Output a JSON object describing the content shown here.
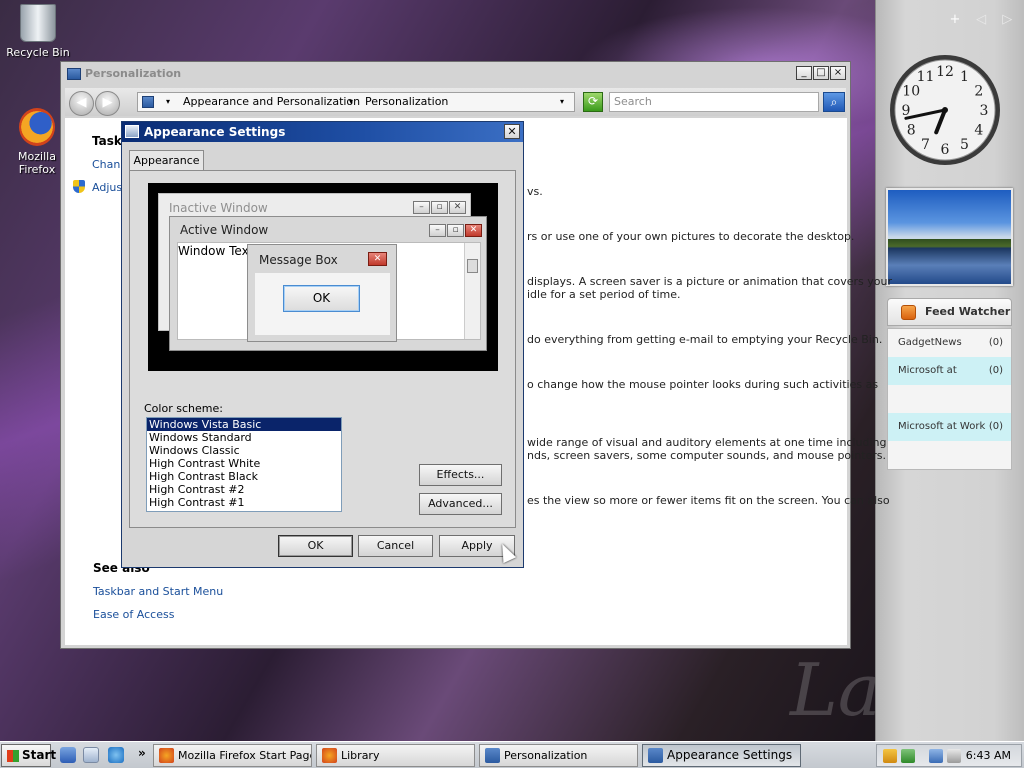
{
  "desktop": {
    "icons": [
      {
        "label": "Recycle Bin",
        "icon": "recycle-bin-icon"
      },
      {
        "label": "Mozilla Firefox",
        "icon": "firefox-icon"
      }
    ],
    "wallpaper_text": "La"
  },
  "sidebar": {
    "controls": [
      "+",
      "◁",
      "▷"
    ],
    "clock": {
      "hour": 6,
      "minute": 43,
      "numbers": [
        "12",
        "1",
        "2",
        "3",
        "4",
        "5",
        "6",
        "7",
        "8",
        "9",
        "10",
        "11"
      ]
    },
    "feed": {
      "title": "Feed Watcher",
      "rows": [
        {
          "name": "GadgetNews",
          "count": "(0)",
          "highlight": false
        },
        {
          "name": "Microsoft at",
          "count": "(0)",
          "highlight": true
        },
        {
          "name": "",
          "count": "",
          "highlight": false
        },
        {
          "name": "Microsoft at Work",
          "count": "(0)",
          "highlight": true
        },
        {
          "name": "",
          "count": "",
          "highlight": false
        }
      ]
    }
  },
  "personalization": {
    "title": "Personalization",
    "window_buttons": {
      "minimize": "_",
      "maximize": "□",
      "close": "×"
    },
    "nav": {
      "back": "◀",
      "forward": "▶",
      "dropdown": "▾"
    },
    "breadcrumbs": [
      "Appearance and Personalization",
      "Personalization"
    ],
    "search_placeholder": "Search",
    "tasks_title": "Task",
    "task_links": [
      "Chang",
      "Adjust"
    ],
    "descriptions": [
      "vs.",
      "rs or use one of your own pictures to decorate the desktop.",
      "displays. A screen saver is a picture or animation that covers your",
      "idle for a set period of time.",
      "do everything from getting e-mail to emptying your Recycle Bin.",
      "o change how the mouse pointer looks during such activities as",
      "wide range of visual and auditory elements at one time including",
      "nds, screen savers, some computer sounds, and mouse pointers.",
      "es the view so more or fewer items fit on the screen. You can also"
    ],
    "see_also_title": "See also",
    "see_also_links": [
      "Taskbar and Start Menu",
      "Ease of Access"
    ]
  },
  "dialog": {
    "title": "Appearance Settings",
    "close": "✕",
    "tab": "Appearance",
    "preview": {
      "inactive_title": "Inactive Window",
      "active_title": "Active Window",
      "window_text": "Window Text",
      "message_title": "Message Box",
      "ok": "OK",
      "mini_buttons": [
        "–",
        "▫",
        "✕"
      ]
    },
    "color_scheme_label": "Color scheme:",
    "color_schemes": [
      "Windows Vista Basic",
      "Windows Standard",
      "Windows Classic",
      "High Contrast White",
      "High Contrast Black",
      "High Contrast #2",
      "High Contrast #1"
    ],
    "selected_scheme": "Windows Vista Basic",
    "effects_button": "Effects...",
    "advanced_button": "Advanced...",
    "ok_button": "OK",
    "cancel_button": "Cancel",
    "apply_button": "Apply"
  },
  "taskbar": {
    "start_label": "Start",
    "more_label": "»",
    "tasks": [
      {
        "label": "Mozilla Firefox Start Page ...",
        "active": false
      },
      {
        "label": "Library",
        "active": false
      },
      {
        "label": "Personalization",
        "active": false
      },
      {
        "label": "Appearance Settings",
        "active": true
      }
    ],
    "time": "6:43 AM"
  }
}
